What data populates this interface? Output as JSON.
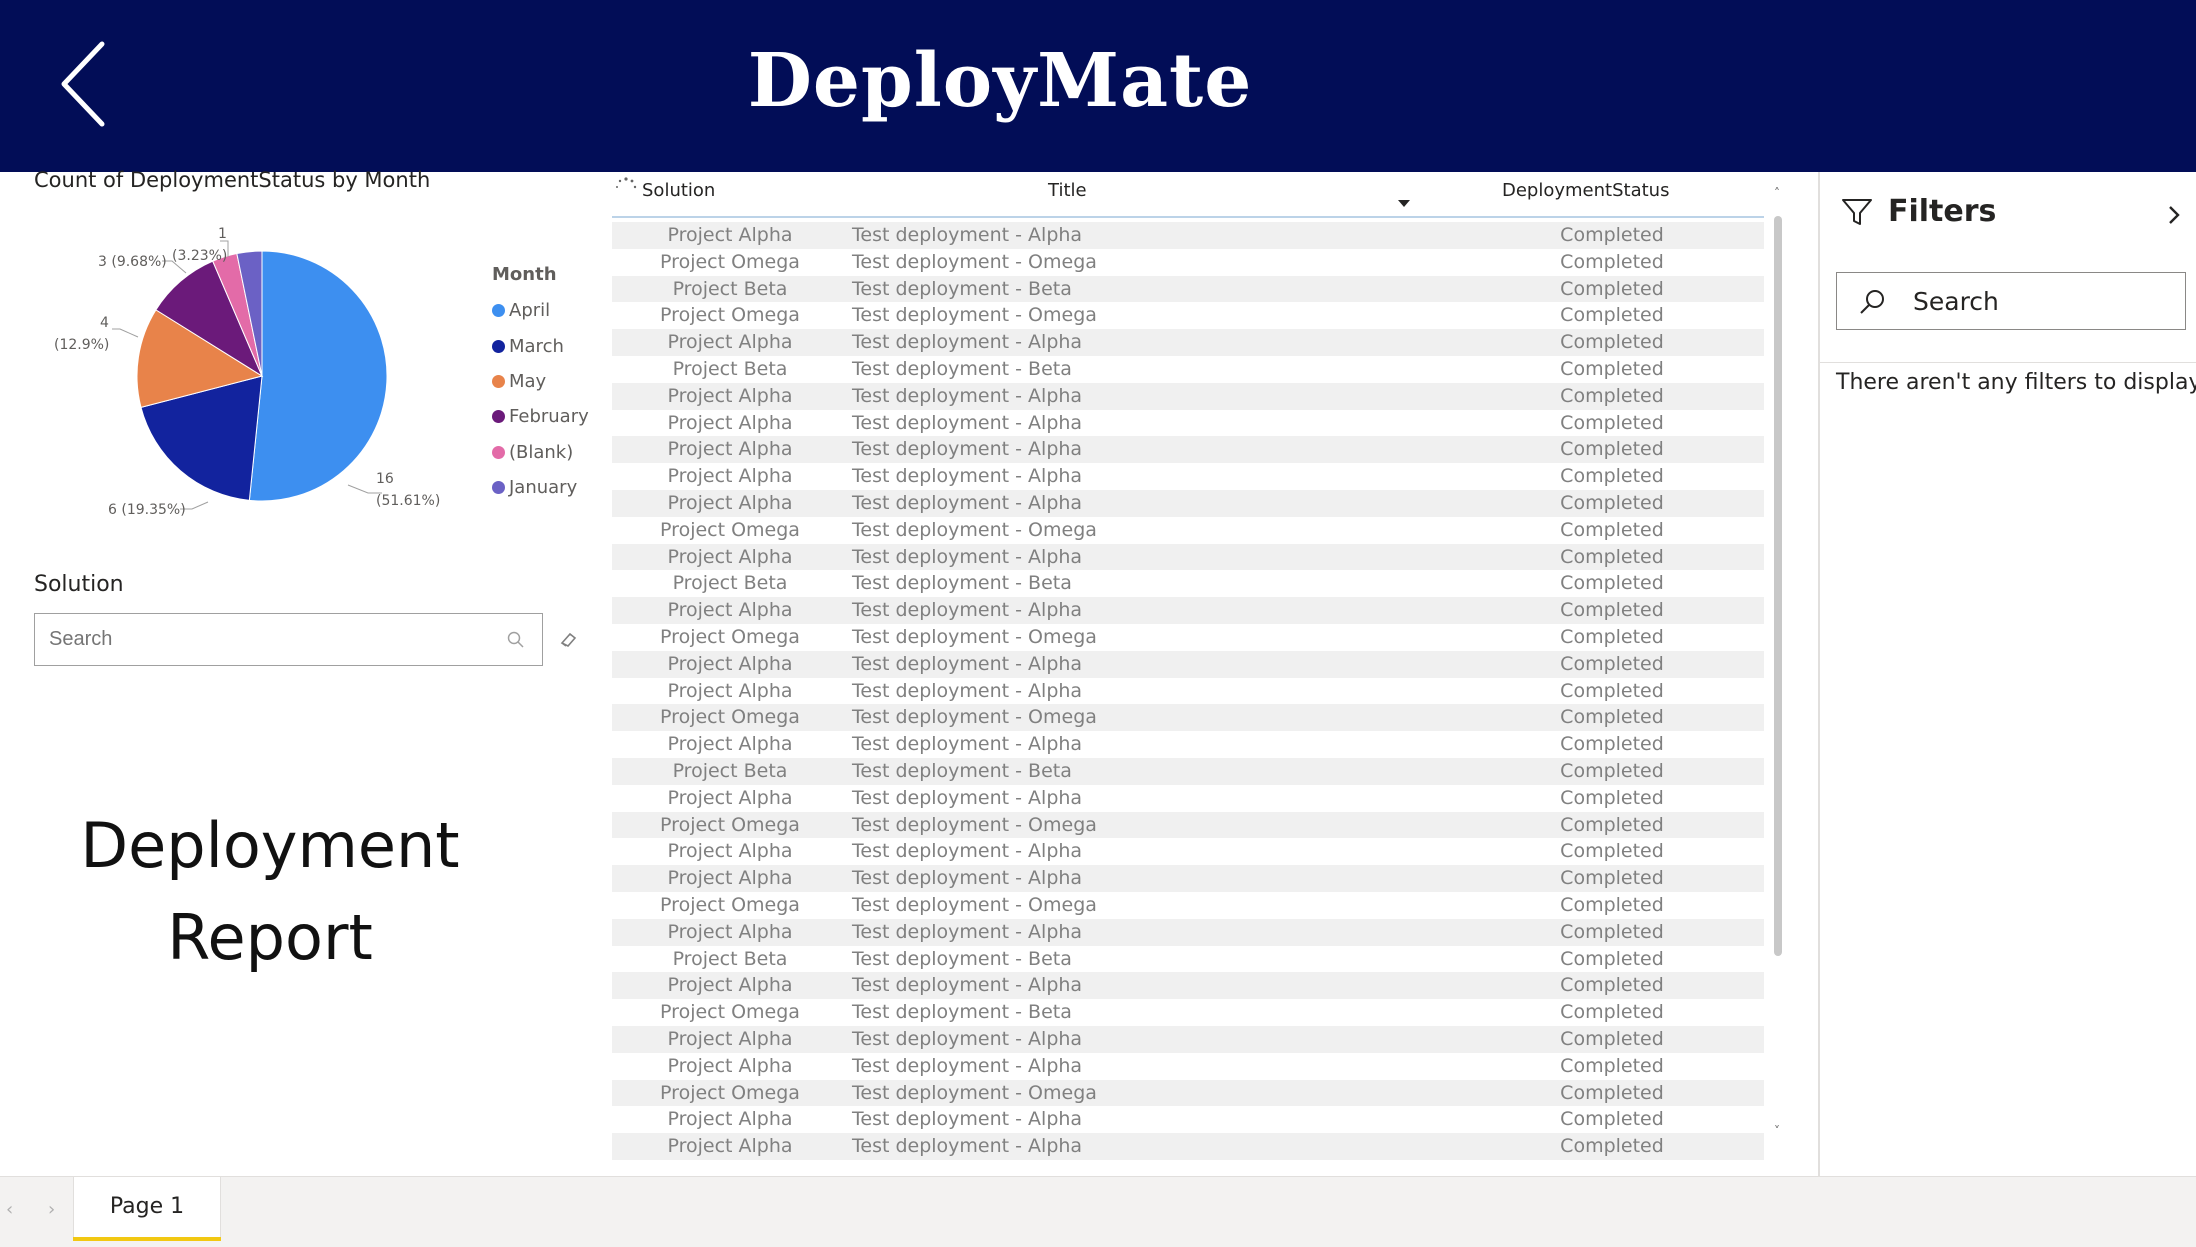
{
  "header": {
    "title": "DeployMate",
    "back_icon": "chevron-left-icon"
  },
  "chart_data": {
    "type": "pie",
    "title": "Count of DeploymentStatus by Month",
    "legend_title": "Month",
    "legend_position": "right",
    "slices": [
      {
        "label": "April",
        "value": 16,
        "percent": "51.61%",
        "color": "#3d8ff0"
      },
      {
        "label": "March",
        "value": 6,
        "percent": "19.35%",
        "color": "#12239e"
      },
      {
        "label": "May",
        "value": 4,
        "percent": "12.9%",
        "color": "#e8834a"
      },
      {
        "label": "February",
        "value": 3,
        "percent": "9.68%",
        "color": "#6b1a7a"
      },
      {
        "label": "(Blank)",
        "value": 1,
        "percent": "3.23%",
        "color": "#e36ba8"
      },
      {
        "label": "January",
        "value": 1,
        "percent": "3.23%",
        "color": "#6b61c5"
      }
    ],
    "data_labels": {
      "april": {
        "value": "16",
        "percent": "(51.61%)"
      },
      "march": "6 (19.35%)",
      "may": {
        "value": "4",
        "percent": "(12.9%)"
      },
      "february": "3 (9.68%)",
      "blank": {
        "value": "1",
        "percent": "(3.23%)"
      }
    }
  },
  "slicer": {
    "title": "Solution",
    "placeholder": "Search"
  },
  "report_title": {
    "line1": "Deployment",
    "line2": "Report"
  },
  "table": {
    "columns": [
      "Solution",
      "Title",
      "DeploymentStatus"
    ],
    "rows": [
      [
        "Project Alpha",
        "Test deployment - Alpha",
        "Completed"
      ],
      [
        "Project Omega",
        "Test deployment - Omega",
        "Completed"
      ],
      [
        "Project Beta",
        "Test deployment - Beta",
        "Completed"
      ],
      [
        "Project Omega",
        "Test deployment - Omega",
        "Completed"
      ],
      [
        "Project Alpha",
        "Test deployment - Alpha",
        "Completed"
      ],
      [
        "Project Beta",
        "Test deployment - Beta",
        "Completed"
      ],
      [
        "Project Alpha",
        "Test deployment - Alpha",
        "Completed"
      ],
      [
        "Project Alpha",
        "Test deployment - Alpha",
        "Completed"
      ],
      [
        "Project Alpha",
        "Test deployment - Alpha",
        "Completed"
      ],
      [
        "Project Alpha",
        "Test deployment - Alpha",
        "Completed"
      ],
      [
        "Project Alpha",
        "Test deployment - Alpha",
        "Completed"
      ],
      [
        "Project Omega",
        "Test deployment - Omega",
        "Completed"
      ],
      [
        "Project Alpha",
        "Test deployment - Alpha",
        "Completed"
      ],
      [
        "Project Beta",
        "Test deployment - Beta",
        "Completed"
      ],
      [
        "Project Alpha",
        "Test deployment - Alpha",
        "Completed"
      ],
      [
        "Project Omega",
        "Test deployment - Omega",
        "Completed"
      ],
      [
        "Project Alpha",
        "Test deployment - Alpha",
        "Completed"
      ],
      [
        "Project Alpha",
        "Test deployment - Alpha",
        "Completed"
      ],
      [
        "Project Omega",
        "Test deployment - Omega",
        "Completed"
      ],
      [
        "Project Alpha",
        "Test deployment - Alpha",
        "Completed"
      ],
      [
        "Project Beta",
        "Test deployment - Beta",
        "Completed"
      ],
      [
        "Project Alpha",
        "Test deployment - Alpha",
        "Completed"
      ],
      [
        "Project Omega",
        "Test deployment - Omega",
        "Completed"
      ],
      [
        "Project Alpha",
        "Test deployment - Alpha",
        "Completed"
      ],
      [
        "Project Alpha",
        "Test deployment - Alpha",
        "Completed"
      ],
      [
        "Project Omega",
        "Test deployment - Omega",
        "Completed"
      ],
      [
        "Project Alpha",
        "Test deployment - Alpha",
        "Completed"
      ],
      [
        "Project Beta",
        "Test deployment - Beta",
        "Completed"
      ],
      [
        "Project Alpha",
        "Test deployment - Alpha",
        "Completed"
      ],
      [
        "Project Omega",
        "Test deployment - Beta",
        "Completed"
      ],
      [
        "Project Alpha",
        "Test deployment - Alpha",
        "Completed"
      ],
      [
        "Project Alpha",
        "Test deployment - Alpha",
        "Completed"
      ],
      [
        "Project Omega",
        "Test deployment - Omega",
        "Completed"
      ],
      [
        "Project Alpha",
        "Test deployment - Alpha",
        "Completed"
      ],
      [
        "Project Alpha",
        "Test deployment - Alpha",
        "Completed"
      ]
    ]
  },
  "filters": {
    "title": "Filters",
    "search_placeholder": "Search",
    "empty_message": "There aren't any filters to display."
  },
  "footer": {
    "page_tab": "Page 1"
  },
  "colors": {
    "header_bg": "#020d57",
    "tab_accent": "#f2c811"
  }
}
